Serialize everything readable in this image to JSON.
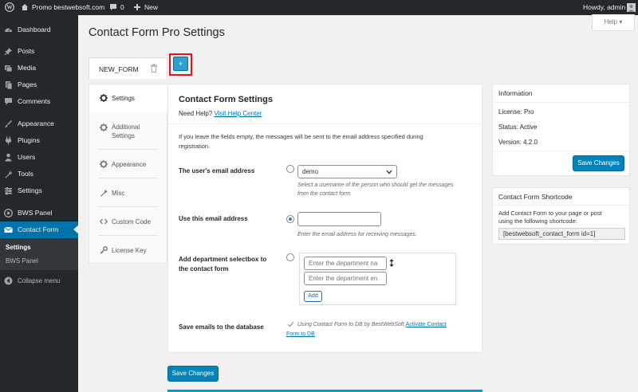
{
  "admin_bar": {
    "site_name": "Promo bestwebsoft.com",
    "comments_count": "0",
    "new_label": "New",
    "howdy": "Howdy, admin"
  },
  "sidebar": {
    "items": [
      {
        "label": "Dashboard",
        "icon": "dashboard-icon"
      },
      {
        "label": "Posts",
        "icon": "pin-icon"
      },
      {
        "label": "Media",
        "icon": "media-icon"
      },
      {
        "label": "Pages",
        "icon": "pages-icon"
      },
      {
        "label": "Comments",
        "icon": "comments-icon"
      },
      {
        "label": "Appearance",
        "icon": "brush-icon"
      },
      {
        "label": "Plugins",
        "icon": "plugin-icon"
      },
      {
        "label": "Users",
        "icon": "users-icon"
      },
      {
        "label": "Tools",
        "icon": "wrench-icon"
      },
      {
        "label": "Settings",
        "icon": "settings-icon"
      },
      {
        "label": "BWS Panel",
        "icon": "bws-icon"
      },
      {
        "label": "Contact Form",
        "icon": "email-icon"
      }
    ],
    "submenu": [
      {
        "label": "Settings"
      },
      {
        "label": "BWS Panel"
      }
    ],
    "collapse_label": "Collapse menu"
  },
  "page": {
    "title": "Contact Form Pro Settings",
    "help_label": "Help ▾",
    "form_tab": "NEW_FORM",
    "add_button": "+"
  },
  "left_nav": [
    {
      "label": "Settings"
    },
    {
      "label": "Additional",
      "label2": "Settings"
    },
    {
      "label": "Appearance"
    },
    {
      "label": "Misc"
    },
    {
      "label": "Custom Code"
    },
    {
      "label": "License Key"
    }
  ],
  "settings": {
    "heading": "Contact Form Settings",
    "need_help": "Need Help?",
    "help_link": "Visit Help Center",
    "intro_line1": "If you leave the fields empty, the messages will be sent to the email address specified during",
    "intro_line2": "registration.",
    "user_email_label": "The user's email address",
    "user_select_value": "demo",
    "user_desc_line1": "Select a username of the person who should get the messages",
    "user_desc_line2": "from the contact form.",
    "use_email_label": "Use this email address",
    "use_email_value": "",
    "use_email_desc": "Enter the email address for receiving messages.",
    "dept_label_line1": "Add department selectbox to",
    "dept_label_line2": "the contact form",
    "dept_placeholder1": "Enter the department na",
    "dept_placeholder2": "Enter the department en",
    "add_label": "Add",
    "save_db_label": "Save emails to the database",
    "save_db_desc_line1": "Using Contact Form to DB by BestWebSoft",
    "save_db_link_part1": "Activate Contact",
    "save_db_link_part2": "Form to DB",
    "save_changes": "Save Changes"
  },
  "info": {
    "title": "Information",
    "license": "License: Pro",
    "status": "Status: Active",
    "version": "Version: 4.2.0",
    "save_changes": "Save Changes"
  },
  "shortcode": {
    "title": "Contact Form Shortcode",
    "desc_line1": "Add Contact Form to your page or post",
    "desc_line2": "using the following shortcode:",
    "value": "[bestwebsoft_contact_form id=1]"
  },
  "colors": {
    "accent": "#0073aa",
    "highlight": "#e3141e",
    "sidebar_bg": "#23282d"
  }
}
